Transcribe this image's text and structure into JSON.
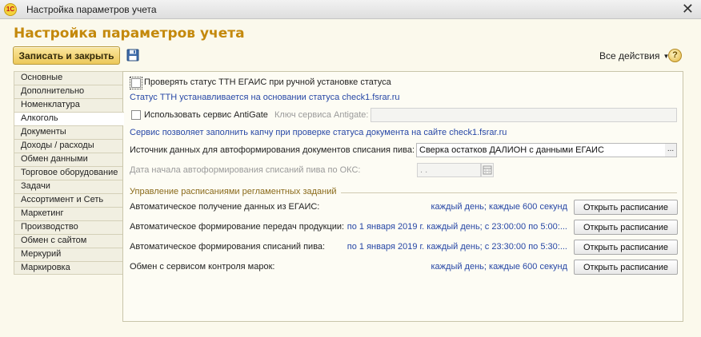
{
  "window": {
    "title": "Настройка параметров учета",
    "app_icon_text": "1С",
    "close_glyph": "✕"
  },
  "header": {
    "heading": "Настройка параметров учета",
    "save_close_label": "Записать и закрыть",
    "all_actions_label": "Все действия",
    "help_label": "?"
  },
  "sidebar": {
    "items": [
      {
        "label": "Основные"
      },
      {
        "label": "Дополнительно"
      },
      {
        "label": "Номенклатура"
      },
      {
        "label": "Алкоголь",
        "active": true
      },
      {
        "label": "Документы"
      },
      {
        "label": "Доходы / расходы"
      },
      {
        "label": "Обмен данными"
      },
      {
        "label": "Торговое оборудование"
      },
      {
        "label": "Задачи"
      },
      {
        "label": "Ассортимент и Сеть"
      },
      {
        "label": "Маркетинг"
      },
      {
        "label": "Производство"
      },
      {
        "label": "Обмен с сайтом"
      },
      {
        "label": "Меркурий"
      },
      {
        "label": "Маркировка"
      }
    ]
  },
  "alcohol": {
    "check_ttn_label": "Проверять статус ТТН ЕГАИС при ручной установке статуса",
    "check_ttn_hint": "Статус ТТН устанавливается на основании статуса check1.fsrar.ru",
    "antigate_label": "Использовать сервис AntiGate",
    "antigate_key_label": "Ключ сервиса Antigate:",
    "antigate_key_value": "",
    "antigate_hint": "Сервис позволяет заполнить капчу при проверке статуса документа на сайте check1.fsrar.ru",
    "beer_source_label": "Источник данных для автоформирования документов списания пива:",
    "beer_source_value": "Сверка остатков ДАЛИОН с данными ЕГАИС",
    "beer_start_label": "Дата начала автоформирования списаний пива по ОКС:",
    "beer_start_value": " .  ."
  },
  "schedules": {
    "section_title": "Управление расписаниями регламентных заданий",
    "button_label": "Открыть расписание",
    "rows": [
      {
        "label": "Автоматическое получение данных из ЕГАИС:",
        "schedule": "каждый день; каждые 600 секунд"
      },
      {
        "label": "Автоматическое формирование передач продукции:",
        "schedule": "по 1 января 2019 г. каждый день; с 23:00:00 по 5:00:..."
      },
      {
        "label": "Автоматическое формирования списаний пива:",
        "schedule": "по 1 января 2019 г. каждый день; с 23:30:00 по 5:30:..."
      },
      {
        "label": "Обмен с сервисом контроля марок:",
        "schedule": "каждый день; каждые 600 секунд"
      }
    ]
  }
}
